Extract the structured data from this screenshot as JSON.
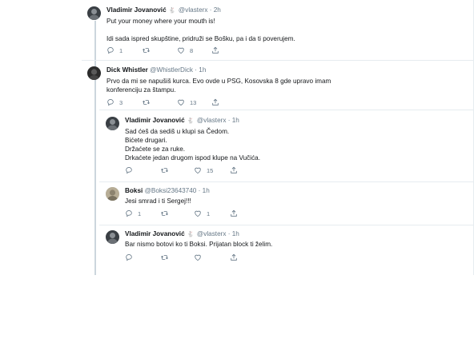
{
  "tweets": [
    {
      "name": "Vladimir Jovanović",
      "handle": "@vlasterx",
      "badge": "🐇",
      "dot": "·",
      "time": "2h",
      "lines": [
        "Put your money where your mouth is!",
        "",
        "Idi sada ispred skupštine, pridruži se Bošku, pa i da ti poverujem."
      ],
      "replies": "1",
      "retweets": "",
      "likes": "8"
    },
    {
      "name": "Dick Whistler",
      "handle": "@WhistlerDick",
      "badge": "",
      "dot": "·",
      "time": "1h",
      "lines": [
        "Prvo da mi se napušiš kurca. Evo ovde u PSG, Kosovska 8 gde upravo imam",
        "konferenciju za štampu."
      ],
      "replies": "3",
      "retweets": "",
      "likes": "13"
    },
    {
      "name": "Vladimir Jovanović",
      "handle": "@vlasterx",
      "badge": "🐇",
      "dot": "·",
      "time": "1h",
      "lines": [
        "Sad ćeš da sediš u klupi sa Čedom.",
        "Bićete drugari.",
        "Držaćete se za ruke.",
        "Drkaćete jedan drugom ispod klupe na Vučića."
      ],
      "replies": "",
      "retweets": "",
      "likes": "15"
    },
    {
      "name": "Boksi",
      "handle": "@Boksi23643740",
      "badge": "",
      "dot": "·",
      "time": "1h",
      "lines": [
        "Jesi smrad i ti Sergej!!!"
      ],
      "replies": "1",
      "retweets": "",
      "likes": "1"
    },
    {
      "name": "Vladimir Jovanović",
      "handle": "@vlasterx",
      "badge": "🐇",
      "dot": "·",
      "time": "1h",
      "lines": [
        "Bar nismo botovi ko ti Boksi. Prijatan block ti želim."
      ],
      "replies": "",
      "retweets": "",
      "likes": ""
    }
  ],
  "icons": {
    "reply": "reply-icon",
    "retweet": "retweet-icon",
    "like": "like-icon",
    "share": "share-icon"
  },
  "colors": {
    "text": "#14171a",
    "muted": "#657786",
    "line": "#ccd6dd",
    "divider": "#e6ecf0"
  }
}
